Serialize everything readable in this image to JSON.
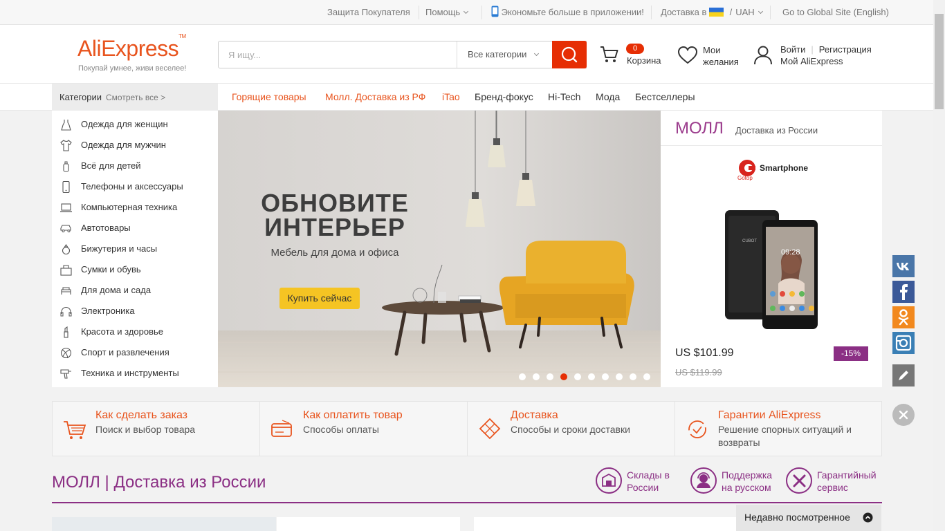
{
  "topbar": {
    "buyer_protection": "Защита Покупателя",
    "help": "Помощь",
    "app": "Экономьте больше в приложении!",
    "delivery_to": "Доставка в",
    "currency": "UAH",
    "global_site": "Go to Global Site (English)"
  },
  "header": {
    "logo": "AliExpress",
    "slogan": "Покупай умнее, живи веселее!",
    "search_placeholder": "Я ищу...",
    "category_select": "Все категории",
    "cart_count": "0",
    "cart_label": "Корзина",
    "wishlist_line1": "Мои",
    "wishlist_line2": "желания",
    "login": "Войти",
    "register": "Регистрация",
    "my_account": "Мой AliExpress"
  },
  "nav": {
    "categories": "Категории",
    "see_all": "Смотреть все >",
    "items": [
      {
        "label": "Горящие товары",
        "color": "#e8541e"
      },
      {
        "label": "Молл. Доставка из РФ",
        "color": "#e8541e"
      },
      {
        "label": "iTao",
        "color": "#e8541e"
      },
      {
        "label": "Бренд-фокус",
        "color": "#333333"
      },
      {
        "label": "Hi-Tech",
        "color": "#333333"
      },
      {
        "label": "Мода",
        "color": "#333333"
      },
      {
        "label": "Бестселлеры",
        "color": "#333333"
      }
    ]
  },
  "categories": [
    {
      "label": "Одежда для женщин",
      "icon": "dress-icon"
    },
    {
      "label": "Одежда для мужчин",
      "icon": "shirt-icon"
    },
    {
      "label": "Всё для детей",
      "icon": "baby-bottle-icon"
    },
    {
      "label": "Телефоны и аксессуары",
      "icon": "phone-icon"
    },
    {
      "label": "Компьютерная техника",
      "icon": "laptop-icon"
    },
    {
      "label": "Автотовары",
      "icon": "car-icon"
    },
    {
      "label": "Бижутерия и часы",
      "icon": "ring-icon"
    },
    {
      "label": "Сумки и обувь",
      "icon": "bag-icon"
    },
    {
      "label": "Для дома и сада",
      "icon": "sofa-icon"
    },
    {
      "label": "Электроника",
      "icon": "headphones-icon"
    },
    {
      "label": "Красота и здоровье",
      "icon": "lipstick-icon"
    },
    {
      "label": "Спорт и развлечения",
      "icon": "ball-icon"
    },
    {
      "label": "Техника и инструменты",
      "icon": "drill-icon"
    }
  ],
  "banner": {
    "title_line1": "ОБНОВИТЕ",
    "title_line2": "ИНТЕРЬЕР",
    "subtitle": "Мебель для дома и офиса",
    "cta": "Купить сейчас",
    "slides": 10,
    "active_slide": 4
  },
  "mall": {
    "title": "МОЛЛ",
    "subtitle": "Доставка из России",
    "brand": "Smartphone",
    "brand_sub": "Gotop",
    "phone_brand": "CUBOT",
    "phone_time": "09:28",
    "price": "US $101.99",
    "old_price": "US $119.99",
    "discount": "-15%"
  },
  "info": [
    {
      "title": "Как сделать заказ",
      "sub": "Поиск и выбор товара",
      "icon": "cart-icon"
    },
    {
      "title": "Как оплатить товар",
      "sub": "Способы оплаты",
      "icon": "card-icon"
    },
    {
      "title": "Доставка",
      "sub": "Способы и сроки доставки",
      "icon": "parcel-icon"
    },
    {
      "title": "Гарантии AliExpress",
      "sub": "Решение спорных ситуаций и возвраты",
      "icon": "guarantee-icon"
    }
  ],
  "mall_section": {
    "title": "МОЛЛ | Доставка из России",
    "features": [
      {
        "line1": "Склады в",
        "line2": "России"
      },
      {
        "line1": "Поддержка",
        "line2": "на русском"
      },
      {
        "line1": "Гарантийный",
        "line2": "сервис"
      }
    ]
  },
  "recent": "Недавно посмотренное",
  "colors": {
    "accent": "#e62e04",
    "brand": "#e8541e",
    "mall": "#8b2f84"
  }
}
